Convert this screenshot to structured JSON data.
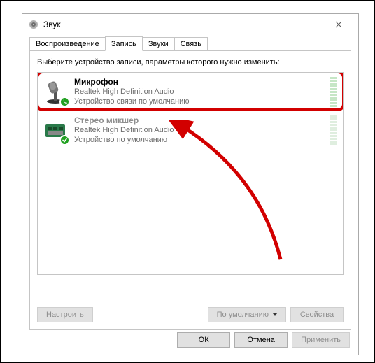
{
  "window": {
    "title": "Звук"
  },
  "tabs": {
    "playback": "Воспроизведение",
    "recording": "Запись",
    "sounds": "Звуки",
    "communications": "Связь"
  },
  "instruction": "Выберите устройство записи, параметры которого нужно изменить:",
  "devices": [
    {
      "name": "Микрофон",
      "driver": "Realtek High Definition Audio",
      "status": "Устройство связи по умолчанию",
      "icon": "microphone",
      "badge": "phone",
      "bars": 11,
      "disabled": false,
      "highlighted": true
    },
    {
      "name": "Стерео микшер",
      "driver": "Realtek High Definition Audio",
      "status": "Устройство по умолчанию",
      "icon": "soundcard",
      "badge": "check",
      "bars": 11,
      "disabled": true,
      "highlighted": false
    }
  ],
  "panel_buttons": {
    "configure": "Настроить",
    "default": "По умолчанию",
    "properties": "Свойства"
  },
  "dialog_buttons": {
    "ok": "ОК",
    "cancel": "Отмена",
    "apply": "Применить"
  }
}
